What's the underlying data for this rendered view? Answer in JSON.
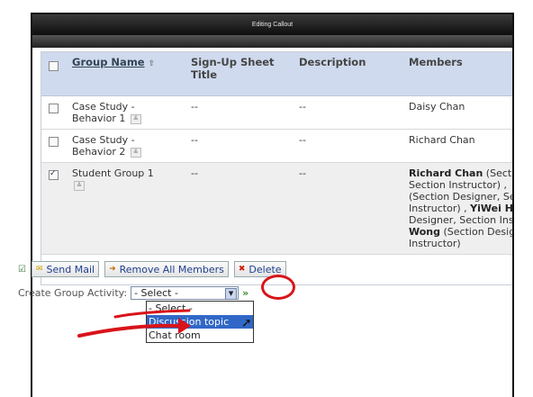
{
  "window": {
    "title": "Editing Callout"
  },
  "table": {
    "headers": {
      "group_name": "Group Name",
      "signup": "Sign-Up Sheet Title",
      "description": "Description",
      "members": "Members"
    },
    "rows": [
      {
        "name": "Case Study - Behavior 1",
        "signup": "--",
        "description": "--",
        "members_text": "Daisy Chan",
        "checked": false
      },
      {
        "name": "Case Study - Behavior 2",
        "signup": "--",
        "description": "--",
        "members_text": "Richard Chan",
        "checked": false
      },
      {
        "name": "Student Group 1",
        "signup": "--",
        "description": "--",
        "checked": true,
        "members": {
          "m1": "Richard Chan",
          "r1": " (Secti",
          "l2": "Section Instructor) ,",
          "l3": "(Section Designer, Se",
          "l4": "Instructor) , ",
          "m2": "YiWei H",
          "l5": "Designer, Section Ins",
          "m3": "Wong",
          "r3": " (Section Desig",
          "l7": "Instructor)"
        }
      }
    ]
  },
  "actions": {
    "send_mail": "Send Mail",
    "remove_all": "Remove All Members",
    "delete": "Delete"
  },
  "create_activity": {
    "label": "Create Group Activity:",
    "selected": "- Select -",
    "options": [
      "- Select -",
      "Discussion topic",
      "Chat room"
    ],
    "highlighted_index": 1
  },
  "colors": {
    "header_bg": "#cfdaee",
    "highlight_red": "#d8141a",
    "dropdown_highlight": "#3168c7"
  }
}
